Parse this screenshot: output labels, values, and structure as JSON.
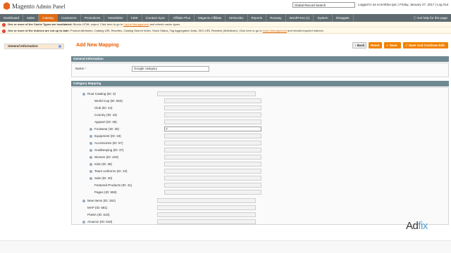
{
  "header": {
    "logo_prefix": "Magento",
    "logo_suffix": "Admin Panel",
    "search_value": "Global Record Search",
    "user_info": "Logged in as ecomfdox-ppc  |  Friday, January 27, 2017  |  Log Out"
  },
  "nav": {
    "items": [
      "Dashboard",
      "Sales",
      "Catalog",
      "Customers",
      "Promotions",
      "Newsletter",
      "CMS",
      "iContact Sync",
      "Affiliate Plus",
      "Magento Affiliate",
      "MANAdev",
      "Reports",
      "Runway",
      "WordPress (1)",
      "System",
      "Shopgate"
    ],
    "active_index": 2,
    "help": "Get help for this page"
  },
  "messages": [
    {
      "prefix": "One or more of the Cache Types are invalidated:",
      "text": " Blocks HTML output. Click here to go to ",
      "link": "Cache Management",
      "suffix": " and refresh cache types."
    },
    {
      "prefix": "One or more of the indexes are not up to date:",
      "text": " Product Attributes, Catalog URL Rewrites, Catalog Search Index, Stock Status, Tag Aggregation Data, SEO URL Rewrites (MANAdev). Click here to go to ",
      "link": "Index Management",
      "suffix": " and rebuild required indexes."
    }
  ],
  "sidebar": {
    "tab_label": "General Information"
  },
  "page": {
    "title": "Add New Mapping"
  },
  "toolbar": {
    "back": "Back",
    "reset": "Reset",
    "save": "Save",
    "save_continue": "Save And Continue Edit"
  },
  "general": {
    "section_title": "General Information",
    "name_label": "Name",
    "name_required": "*",
    "name_value": "Google category"
  },
  "mapping": {
    "section_title": "Category Mapping",
    "rows": [
      {
        "label": "Root Catalog (ID: 3)",
        "value": ""
      },
      {
        "label": "World Cup (ID: 553)",
        "value": ""
      },
      {
        "label": "Club (ID: 44)",
        "value": ""
      },
      {
        "label": "Country (ID: 43)",
        "value": ""
      },
      {
        "label": "Apparel (ID: 39)",
        "value": ""
      },
      {
        "label": "Footwear (ID: 35)",
        "value": "Y"
      },
      {
        "label": "Equipment (ID: 18)",
        "value": ""
      },
      {
        "label": "Accessories (ID: 67)",
        "value": ""
      },
      {
        "label": "Goalkeeping (ID: 37)",
        "value": ""
      },
      {
        "label": "Women (ID: 433)",
        "value": ""
      },
      {
        "label": "Kids (ID: 38)",
        "value": ""
      },
      {
        "label": "Team Uniforms (ID: 10)",
        "value": ""
      },
      {
        "label": "Sale (ID: 40)",
        "value": ""
      },
      {
        "label": "Featured Products (ID: 41)",
        "value": ""
      },
      {
        "label": "Pages (ID: 559)",
        "value": ""
      },
      {
        "label": "New Items (ID: 291)",
        "value": ""
      },
      {
        "label": "MAP (ID: 581)",
        "value": ""
      },
      {
        "label": "PUMA (ID: 610)",
        "value": ""
      },
      {
        "label": "Amazon (ID: 618)",
        "value": ""
      }
    ]
  },
  "watermark": {
    "part1": "Ad",
    "part2": "fix"
  }
}
